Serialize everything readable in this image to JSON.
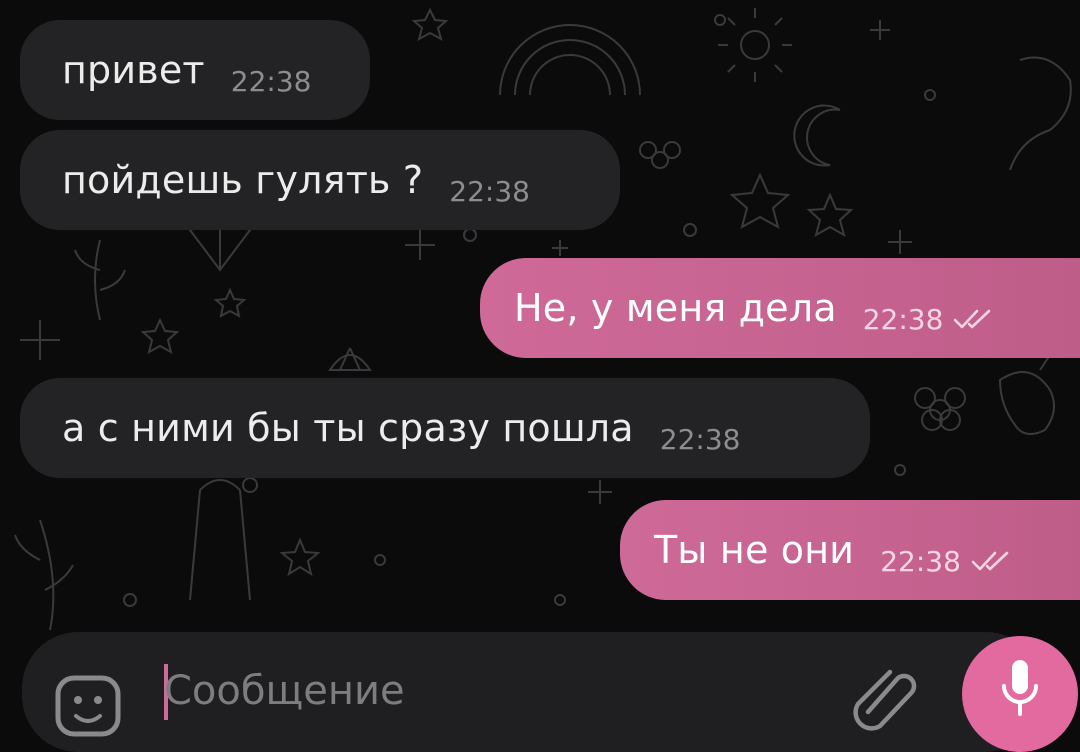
{
  "chat": {
    "messages": [
      {
        "direction": "incoming",
        "text": "привет",
        "time": "22:38"
      },
      {
        "direction": "incoming",
        "text": "пойдешь гулять ?",
        "time": "22:38"
      },
      {
        "direction": "outgoing",
        "text": "Не, у меня дела",
        "time": "22:38",
        "status": "read"
      },
      {
        "direction": "incoming",
        "text": "а с ними бы ты сразу пошла",
        "time": "22:38"
      },
      {
        "direction": "outgoing",
        "text": "Ты не они",
        "time": "22:38",
        "status": "read"
      }
    ]
  },
  "composer": {
    "placeholder": "Сообщение",
    "emoji_icon": "emoji-icon",
    "attach_icon": "paperclip-icon",
    "mic_icon": "microphone-icon"
  },
  "theme": {
    "background": "#0b0b0c",
    "incoming_bubble": "#232325",
    "outgoing_bubble": "#c8649a",
    "accent": "#e26a9f"
  }
}
